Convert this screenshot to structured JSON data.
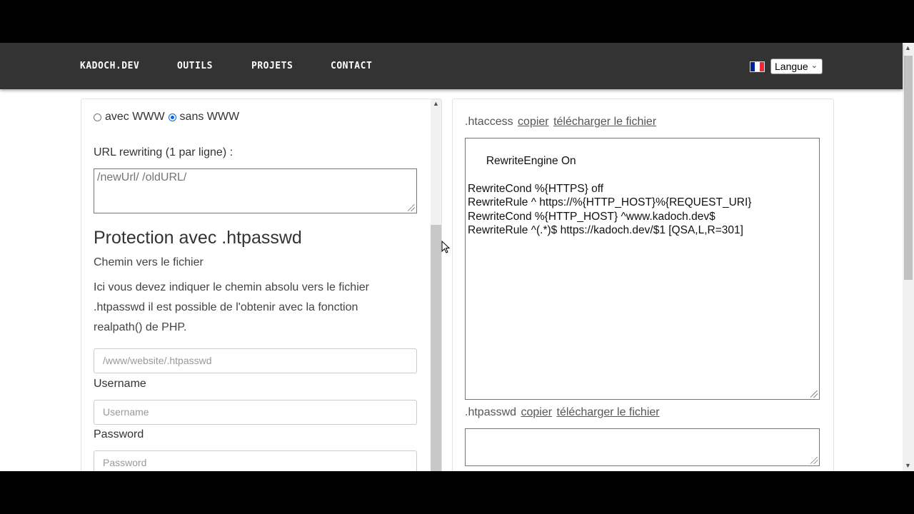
{
  "nav": {
    "links": [
      "KADOCH.DEV",
      "OUTILS",
      "PROJETS",
      "CONTACT"
    ],
    "language_label": "Langue",
    "flag_colors": [
      "#002395",
      "#ffffff",
      "#ed2939"
    ]
  },
  "left": {
    "radio_with": "avec WWW",
    "radio_without": "sans WWW",
    "selected_radio": "sans WWW",
    "rewrite_label": "URL rewriting (1 par ligne) :",
    "rewrite_placeholder": "/newUrl/ /oldURL/",
    "protection_title": "Protection avec .htpasswd",
    "path_label": "Chemin vers le fichier",
    "path_help": "Ici vous devez indiquer le chemin absolu vers le fichier .htpasswd il est possible de l'obtenir avec la fonction realpath() de PHP.",
    "path_placeholder": "/www/website/.htpasswd",
    "username_label": "Username",
    "username_placeholder": "Username",
    "password_label": "Password",
    "password_placeholder": "Password"
  },
  "right": {
    "htaccess_label": ".htaccess",
    "copy_label": "copier",
    "download_label": "télécharger le fichier",
    "htaccess_content": "RewriteEngine On\n\nRewriteCond %{HTTPS} off\nRewriteRule ^ https://%{HTTP_HOST}%{REQUEST_URI}\nRewriteCond %{HTTP_HOST} ^www.kadoch.dev$\nRewriteRule ^(.*)$ https://kadoch.dev/$1 [QSA,L,R=301]",
    "htpasswd_label": ".htpasswd",
    "htpasswd_content": ""
  }
}
